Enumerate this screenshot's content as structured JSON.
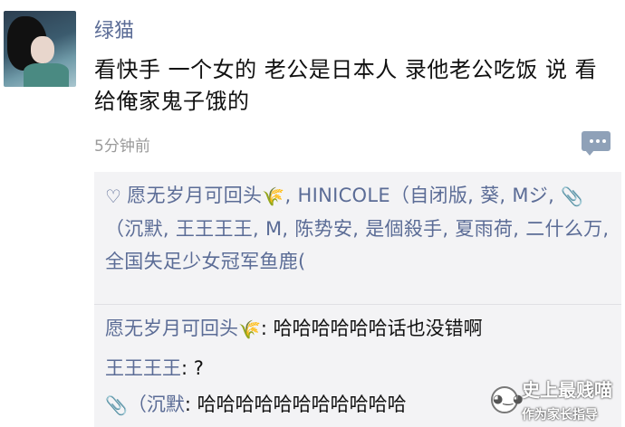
{
  "post": {
    "username": "绿猫",
    "text": "看快手 一个女的 老公是日本人 录他老公吃饭 说 看给俺家鬼子饿的",
    "time": "5分钟前"
  },
  "likes": {
    "names_part1": "愿无岁月可回头",
    "names_part2": ", HINICOLE（自闭版, 葵, M",
    "names_part3": "（沉默, 王王王王, M, 陈势安, 是個殺手, 夏雨荷, 二什么万, 全国失足少女冠军鱼鹿("
  },
  "comments": [
    {
      "author": "愿无岁月可回头",
      "text": ": 哈哈哈哈哈哈话也没错啊"
    },
    {
      "author": "王王王王",
      "text": ": ?"
    },
    {
      "author": "（沉默",
      "text": ": 哈哈哈哈哈哈哈哈哈哈哈"
    }
  ],
  "watermark": {
    "line1": "史上最贱喵",
    "line2": "作为家长指导"
  },
  "icons": {
    "heart": "heart-icon",
    "wheat": "wheat-emoji-icon",
    "paperclip": "paperclip-emoji-icon",
    "comment": "comment-icon"
  },
  "colors": {
    "name_link": "#5b6c96",
    "time": "#9a9a9a",
    "panel_bg": "#f3f3f5"
  }
}
